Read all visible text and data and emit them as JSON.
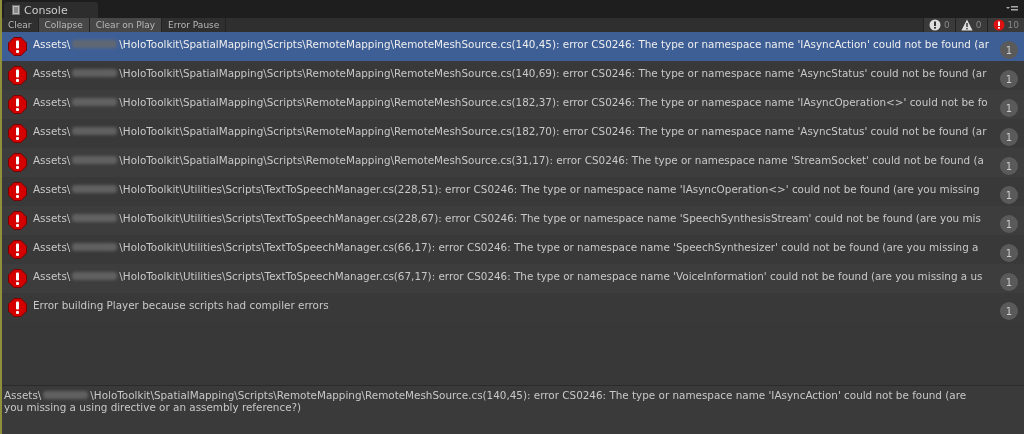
{
  "window": {
    "tab": "Console"
  },
  "toolbar": [
    {
      "label": "Clear",
      "kind": "button"
    },
    {
      "label": "Collapse",
      "kind": "toggle",
      "on": true
    },
    {
      "label": "Clear on Play",
      "kind": "toggle",
      "on": true
    },
    {
      "label": "Error Pause",
      "kind": "toggle",
      "on": false
    }
  ],
  "counters": [
    {
      "kind": "info",
      "count": "0"
    },
    {
      "kind": "warning",
      "count": "0"
    },
    {
      "kind": "error",
      "count": "10"
    }
  ],
  "entries": [
    {
      "selected": true,
      "redacted": true,
      "prefix": "Assets\\",
      "text": "\\HoloToolkit\\SpatialMapping\\Scripts\\RemoteMapping\\RemoteMeshSource.cs(140,45): error CS0246: The type or namespace name 'IAsyncAction' could not be found (ar",
      "count": "1"
    },
    {
      "selected": false,
      "redacted": true,
      "prefix": "Assets\\",
      "text": "\\HoloToolkit\\SpatialMapping\\Scripts\\RemoteMapping\\RemoteMeshSource.cs(140,69): error CS0246: The type or namespace name 'AsyncStatus' could not be found (ar",
      "count": "1"
    },
    {
      "selected": false,
      "redacted": true,
      "prefix": "Assets\\",
      "text": "\\HoloToolkit\\SpatialMapping\\Scripts\\RemoteMapping\\RemoteMeshSource.cs(182,37): error CS0246: The type or namespace name 'IAsyncOperation<>' could not be fo",
      "count": "1"
    },
    {
      "selected": false,
      "redacted": true,
      "prefix": "Assets\\",
      "text": "\\HoloToolkit\\SpatialMapping\\Scripts\\RemoteMapping\\RemoteMeshSource.cs(182,70): error CS0246: The type or namespace name 'AsyncStatus' could not be found (ar",
      "count": "1"
    },
    {
      "selected": false,
      "redacted": true,
      "prefix": "Assets\\",
      "text": "\\HoloToolkit\\SpatialMapping\\Scripts\\RemoteMapping\\RemoteMeshSource.cs(31,17): error CS0246: The type or namespace name 'StreamSocket' could not be found (a",
      "count": "1"
    },
    {
      "selected": false,
      "redacted": true,
      "prefix": "Assets\\",
      "text": "\\HoloToolkit\\Utilities\\Scripts\\TextToSpeechManager.cs(228,51): error CS0246: The type or namespace name 'IAsyncOperation<>' could not be found (are you missing",
      "count": "1"
    },
    {
      "selected": false,
      "redacted": true,
      "prefix": "Assets\\",
      "text": "\\HoloToolkit\\Utilities\\Scripts\\TextToSpeechManager.cs(228,67): error CS0246: The type or namespace name 'SpeechSynthesisStream' could not be found (are you mis",
      "count": "1"
    },
    {
      "selected": false,
      "redacted": true,
      "prefix": "Assets\\",
      "text": "\\HoloToolkit\\Utilities\\Scripts\\TextToSpeechManager.cs(66,17): error CS0246: The type or namespace name 'SpeechSynthesizer' could not be found (are you missing a",
      "count": "1"
    },
    {
      "selected": false,
      "redacted": true,
      "prefix": "Assets\\",
      "text": "\\HoloToolkit\\Utilities\\Scripts\\TextToSpeechManager.cs(67,17): error CS0246: The type or namespace name 'VoiceInformation' could not be found (are you missing a us",
      "count": "1"
    },
    {
      "selected": false,
      "redacted": false,
      "text": "Error building Player because scripts had compiler errors",
      "count": "1"
    }
  ],
  "detail": {
    "prefix": "Assets\\",
    "text": "\\HoloToolkit\\SpatialMapping\\Scripts\\RemoteMapping\\RemoteMeshSource.cs(140,45): error CS0246: The type or namespace name 'IAsyncAction' could not be found (are you missing a using directive or an assembly reference?)"
  }
}
